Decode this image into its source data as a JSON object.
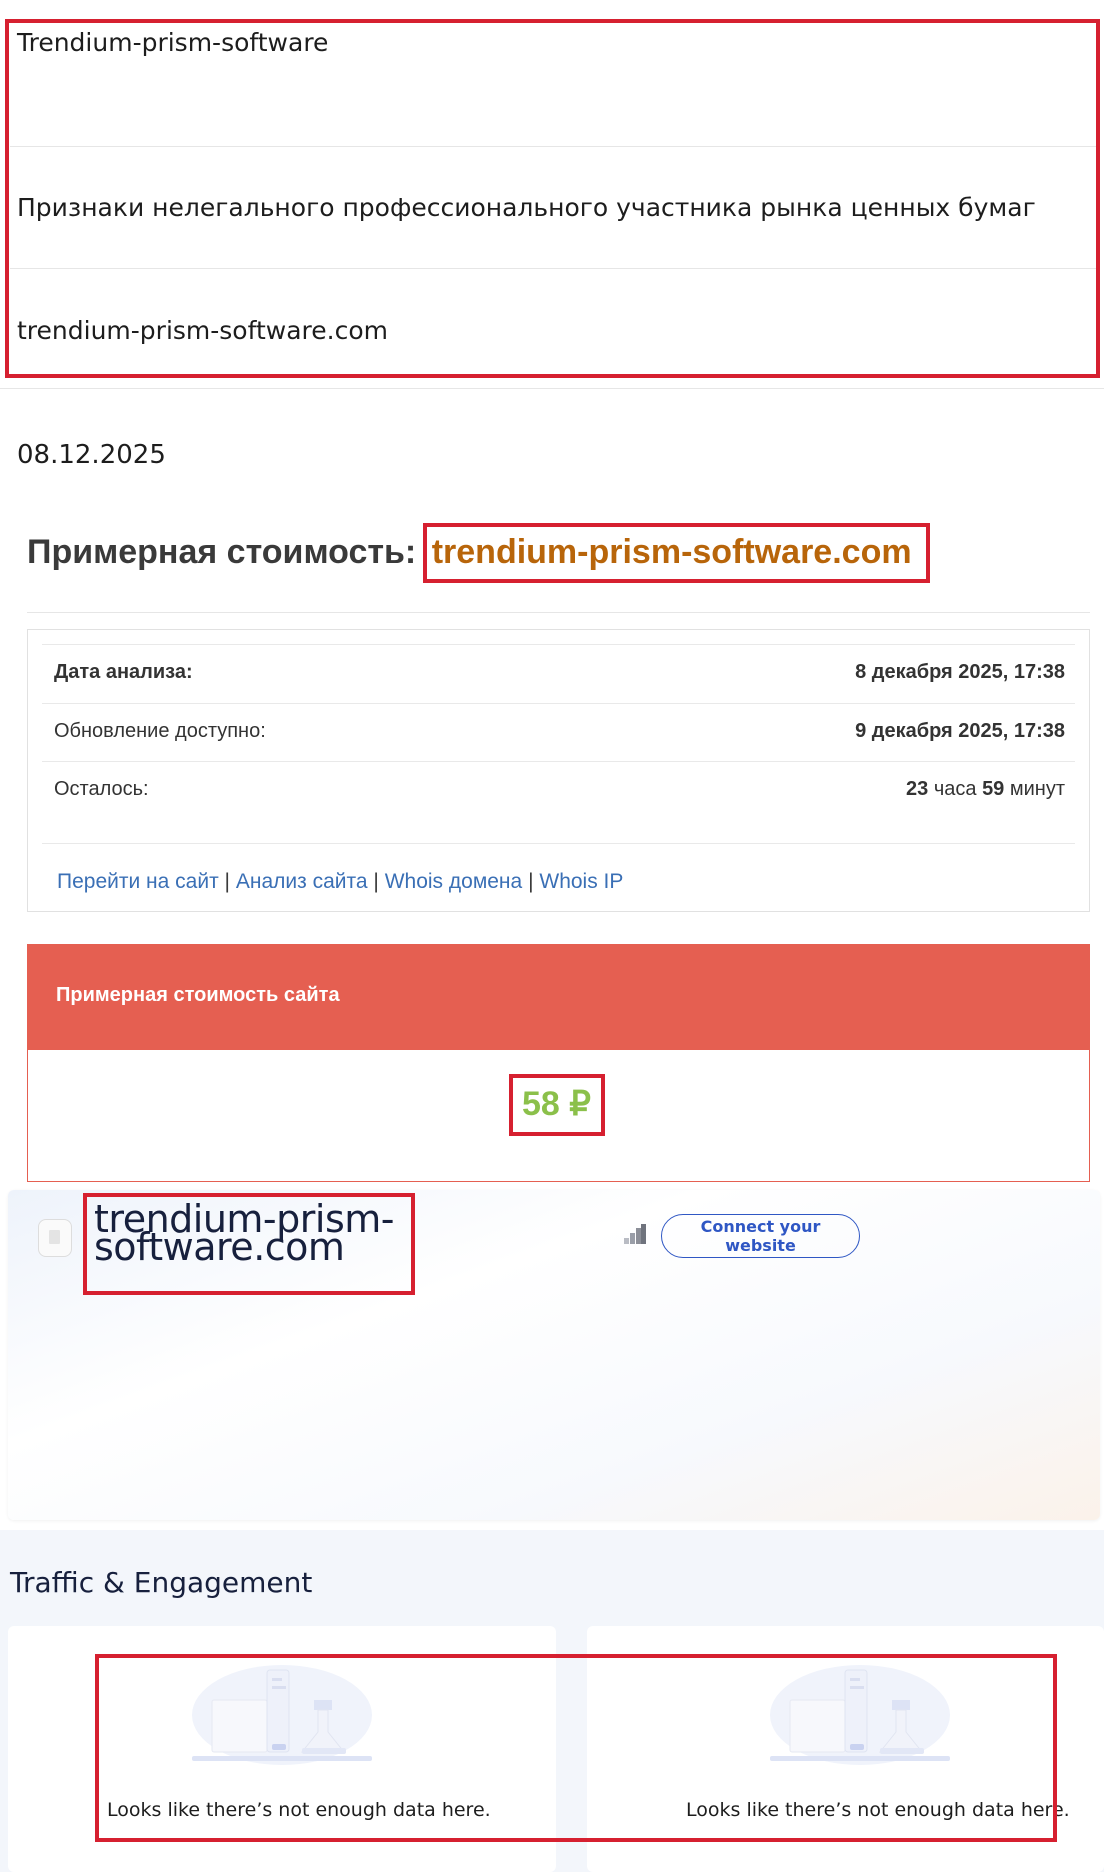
{
  "top_table": {
    "name": "Trendium-prism-software",
    "status": "Признаки нелегального профессионального участника рынка ценных бумаг",
    "domain": "trendium-prism-software.com"
  },
  "date": "08.12.2025",
  "price_section": {
    "heading": "Примерная стоимость:",
    "domain": "trendium-prism-software.com",
    "rows": [
      {
        "label": "Дата анализа:",
        "value": "8 декабря 2025, 17:38"
      },
      {
        "label": "Обновление доступно:",
        "value": "9 декабря 2025, 17:38"
      },
      {
        "label": "Осталось:",
        "value_bold1": "23",
        "value_mid": " часа ",
        "value_bold2": "59",
        "value_end": " минут"
      }
    ],
    "links": [
      "Перейти на сайт",
      "Анализ сайта",
      "Whois домена",
      "Whois IP"
    ],
    "separator": "|",
    "value_header": "Примерная стоимость сайта",
    "value": "58 ₽"
  },
  "site_card": {
    "favicon_icon": "document-icon",
    "title": "trendium-prism-software.com",
    "rank_icon": "bar-chart-icon",
    "connect_label_1": "Connect your",
    "connect_label_2": "website"
  },
  "traffic": {
    "title": "Traffic & Engagement",
    "panels": [
      {
        "message": "Looks like there’s not enough data here.",
        "icon": "lab-flasks-icon"
      },
      {
        "message": "Looks like there’s not enough data here.",
        "icon": "lab-flasks-icon"
      }
    ]
  },
  "colors": {
    "highlight_border": "#d62030",
    "domain_orange": "#b8650a",
    "value_header_bg": "#e55f51",
    "value_green": "#8bc04a",
    "link_blue": "#3a6fb5",
    "connect_blue": "#2f57c4"
  }
}
